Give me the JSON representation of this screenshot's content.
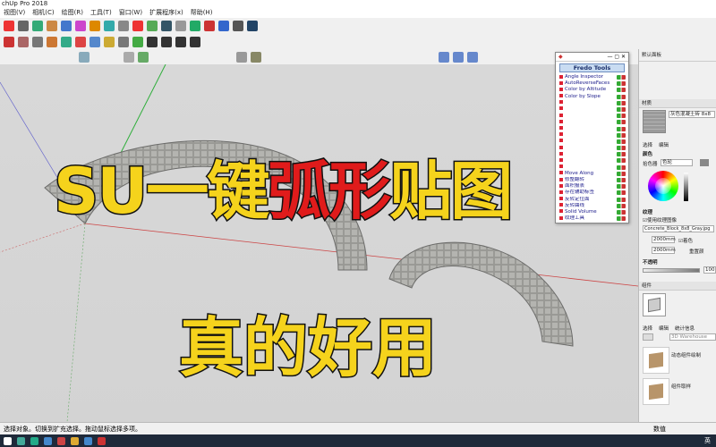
{
  "window": {
    "title": "chUp Pro 2018"
  },
  "menu": [
    "视图(V)",
    "相机(C)",
    "绘图(R)",
    "工具(T)",
    "窗口(W)",
    "扩展程序(x)",
    "帮助(H)"
  ],
  "overlay": {
    "title_part1": "SU一键",
    "title_part2": "弧形",
    "title_part3": "贴图",
    "subtitle": "真的好用"
  },
  "fredo_panel": {
    "title": "Fredo Tools",
    "items": [
      "Angle Inspector",
      "AutoReverseFaces",
      "Color by Altitude",
      "Color by Slope",
      "Move Along",
      "修整翻转",
      "面积报表",
      "存在辅助标签",
      "反转定位面",
      "反转曲线",
      "Solid Volume",
      "纹理工具"
    ]
  },
  "right_panel": {
    "header": "默认面板",
    "materials_section": "材质",
    "material_name": "灰色混凝土砖 8x8",
    "tab_select": "选择",
    "tab_edit": "编辑",
    "color_label": "颜色",
    "picker_label": "拾色器",
    "picker_value": "色轮",
    "texture_label": "纹理",
    "use_texture": "使用纹理图像",
    "texture_file": "Concrete_Block_8x8_Gray.jpg",
    "width_value": "2000mm",
    "height_value": "2000mm",
    "colorize_label": "着色",
    "reset_label": "重置颜",
    "opacity_label": "不透明",
    "opacity_value": "100",
    "components_section": "组件",
    "comp_tab_select": "选择",
    "comp_tab_edit": "编辑",
    "comp_tab_stats": "统计信息",
    "comp_search": "3D Warehouse",
    "comp_item1": "动态组件绘制",
    "comp_item2": "组件取样"
  },
  "status": {
    "text": "选择对象。切换到扩充选择。拖动鼠标选择多项。",
    "right_label": "数值"
  },
  "taskbar": {
    "tray_text": "英"
  },
  "colors": {
    "title_yellow": "#f5d31c",
    "title_red": "#e01b1b",
    "stone_mid": "#a8a8a4"
  }
}
